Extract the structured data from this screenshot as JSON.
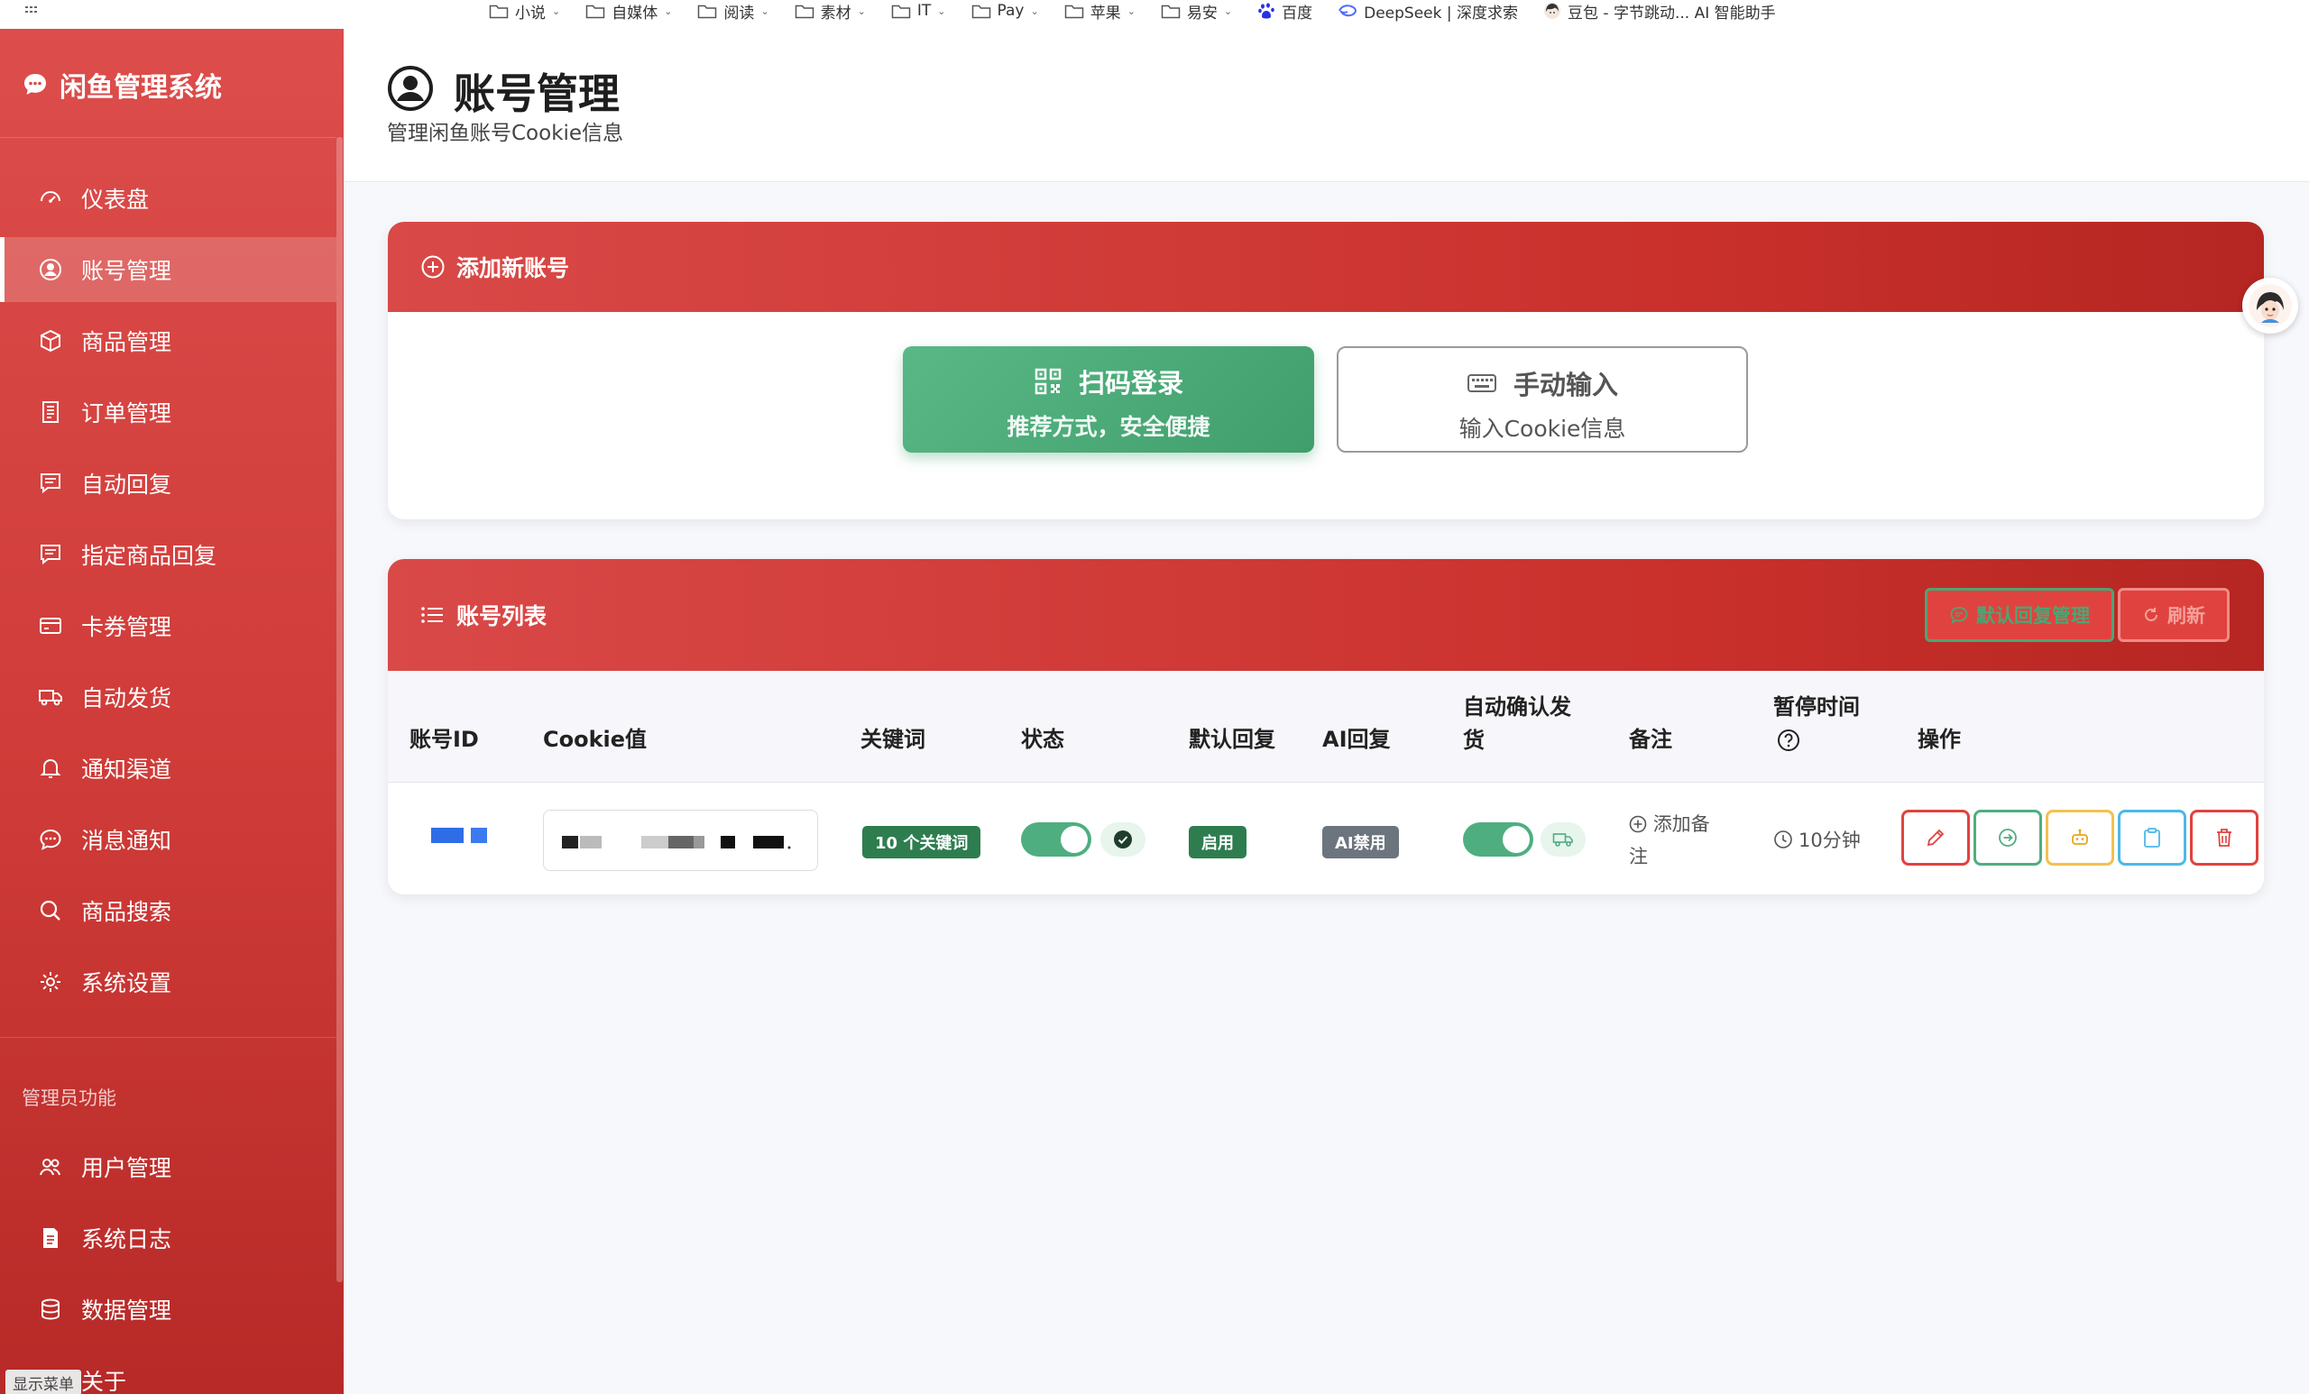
{
  "bookmarks": [
    {
      "label": "小说",
      "type": "folder"
    },
    {
      "label": "自媒体",
      "type": "folder"
    },
    {
      "label": "阅读",
      "type": "folder"
    },
    {
      "label": "素材",
      "type": "folder"
    },
    {
      "label": "IT",
      "type": "folder"
    },
    {
      "label": "Pay",
      "type": "folder"
    },
    {
      "label": "苹果",
      "type": "folder"
    },
    {
      "label": "易安",
      "type": "folder"
    },
    {
      "label": "百度",
      "type": "link"
    },
    {
      "label": "DeepSeek | 深度求索",
      "type": "link"
    },
    {
      "label": "豆包 - 字节跳动... AI 智能助手",
      "type": "link"
    }
  ],
  "sidebar": {
    "brand": "闲鱼管理系统",
    "items": [
      {
        "label": "仪表盘",
        "icon": "dashboard-icon"
      },
      {
        "label": "账号管理",
        "icon": "user-circle-icon",
        "active": true
      },
      {
        "label": "商品管理",
        "icon": "box-icon"
      },
      {
        "label": "订单管理",
        "icon": "receipt-icon"
      },
      {
        "label": "自动回复",
        "icon": "chat-square-icon"
      },
      {
        "label": "指定商品回复",
        "icon": "chat-square-text-icon"
      },
      {
        "label": "卡券管理",
        "icon": "credit-card-icon"
      },
      {
        "label": "自动发货",
        "icon": "truck-icon"
      },
      {
        "label": "通知渠道",
        "icon": "bell-icon"
      },
      {
        "label": "消息通知",
        "icon": "chat-dots-icon"
      },
      {
        "label": "商品搜索",
        "icon": "search-icon"
      },
      {
        "label": "系统设置",
        "icon": "gear-icon"
      }
    ],
    "admin_title": "管理员功能",
    "admin_items": [
      {
        "label": "用户管理",
        "icon": "people-icon"
      },
      {
        "label": "系统日志",
        "icon": "file-text-icon"
      },
      {
        "label": "数据管理",
        "icon": "database-icon"
      },
      {
        "label": "关于",
        "icon": "info-icon"
      }
    ],
    "show_menu": "显示菜单"
  },
  "header": {
    "title": "账号管理",
    "subtitle": "管理闲鱼账号Cookie信息"
  },
  "add_card": {
    "title": "添加新账号",
    "qr_button": {
      "title": "扫码登录",
      "subtitle": "推荐方式，安全便捷"
    },
    "manual_button": {
      "title": "手动输入",
      "subtitle": "输入Cookie信息"
    }
  },
  "list_card": {
    "title": "账号列表",
    "default_reply_button": "默认回复管理",
    "refresh_button": "刷新",
    "columns": [
      "账号ID",
      "Cookie值",
      "关键词",
      "状态",
      "默认回复",
      "AI回复",
      "自动确认发货",
      "备注",
      "暂停时间",
      "操作"
    ],
    "rows": [
      {
        "keywords": "10 个关键词",
        "status_on": true,
        "default_reply": "启用",
        "ai_reply": "AI禁用",
        "auto_confirm_on": true,
        "remark": "添加备注",
        "pause_time": "10分钟"
      }
    ]
  },
  "colors": {
    "sidebar_red": "#d94947",
    "success_green": "#3f9e6c",
    "badge_dark_green": "#2e7d4f",
    "badge_gray": "#6c757d"
  }
}
